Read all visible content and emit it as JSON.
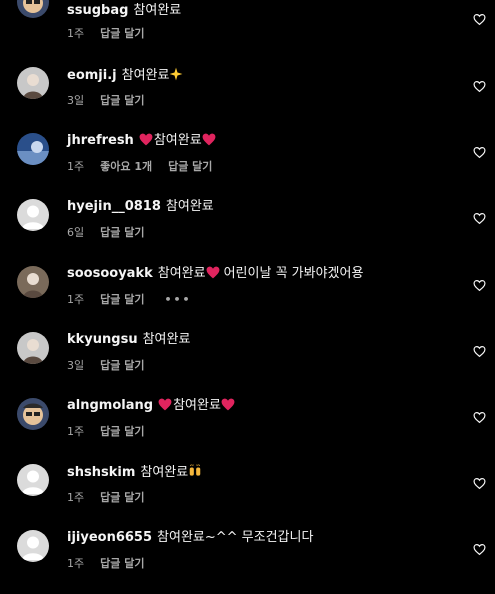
{
  "comments": [
    {
      "username": "ssugbag",
      "text": "참여완료",
      "time": "1주",
      "reply": "답글 달기",
      "avatar": "cartoon-avatar",
      "pre_emoji": "",
      "post_emoji": ""
    },
    {
      "username": "eomji.j",
      "text": "참여완료",
      "time": "3일",
      "reply": "답글 달기",
      "avatar": "photo-avatar",
      "pre_emoji": "",
      "post_emoji": "sparkle-star-emoji"
    },
    {
      "username": "jhrefresh",
      "text": "참여완료",
      "time": "1주",
      "likes": "좋아요 1개",
      "reply": "답글 달기",
      "avatar": "sky-avatar",
      "pre_emoji": "red-heart-emoji",
      "post_emoji": "red-heart-emoji"
    },
    {
      "username": "hyejin__0818",
      "text": "참여완료",
      "time": "6일",
      "reply": "답글 달기",
      "avatar": "default-avatar",
      "pre_emoji": "",
      "post_emoji": ""
    },
    {
      "username": "soosooyakk",
      "text": "참여완료",
      "text2": "어린이날 꼭 가봐야겠어용",
      "time": "1주",
      "reply": "답글 달기",
      "more": "•••",
      "avatar": "photo-avatar",
      "pre_emoji": "",
      "post_emoji": "red-heart-emoji"
    },
    {
      "username": "kkyungsu",
      "text": "참여완료",
      "time": "3일",
      "reply": "답글 달기",
      "avatar": "photo-avatar",
      "pre_emoji": "",
      "post_emoji": ""
    },
    {
      "username": "alngmolang",
      "text": "참여완료",
      "time": "1주",
      "reply": "답글 달기",
      "avatar": "cartoon-avatar",
      "pre_emoji": "red-heart-emoji",
      "post_emoji": "red-heart-emoji"
    },
    {
      "username": "shshskim",
      "text": "참여완료",
      "time": "1주",
      "reply": "답글 달기",
      "avatar": "default-avatar",
      "pre_emoji": "",
      "post_emoji": "raised-hands-emoji"
    },
    {
      "username": "ijiyeon6655",
      "text": "참여완료~^^ 무조건갑니다",
      "time": "1주",
      "reply": "답글 달기",
      "avatar": "default-avatar",
      "pre_emoji": "",
      "post_emoji": ""
    }
  ],
  "colors": {
    "background": "#000000",
    "text": "#f5f5f5",
    "secondary": "#a8a8a8",
    "heart_emoji": "#e0245e"
  }
}
